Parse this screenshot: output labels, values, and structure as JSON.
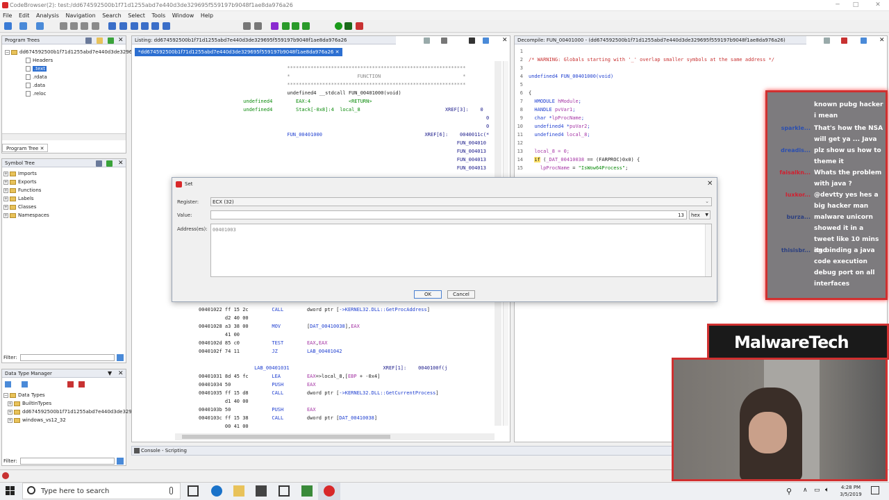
{
  "window": {
    "title": "CodeBrowser(2): test:/dd674592500b1f71d1255abd7e440d3de329695f559197b9048f1ae8da976a26"
  },
  "menu": [
    "File",
    "Edit",
    "Analysis",
    "Navigation",
    "Search",
    "Select",
    "Tools",
    "Window",
    "Help"
  ],
  "program_trees": {
    "title": "Program Trees",
    "root": "dd674592500b1f71d1255abd7e440d3de3296",
    "items": [
      "Headers",
      ".text",
      ".rdata",
      ".data",
      ".reloc"
    ],
    "tab": "Program Tree"
  },
  "symbol_tree": {
    "title": "Symbol Tree",
    "items": [
      "Imports",
      "Exports",
      "Functions",
      "Labels",
      "Classes",
      "Namespaces"
    ]
  },
  "filter_label": "Filter:",
  "data_type_manager": {
    "title": "Data Type Manager",
    "root": "Data Types",
    "items": [
      "BuiltInTypes",
      "dd674592500b1f71d1255abd7e440d3de3296",
      "windows_vs12_32"
    ]
  },
  "listing": {
    "title": "Listing: dd674592500b1f71d1255abd7e440d3de329695f559197b9048f1ae8da976a26",
    "tab": "*dd674592500b1f71d1255abd7e440d3de329695f559197b9048f1ae8da976a26"
  },
  "decompile": {
    "title": "Decompile: FUN_00401000 - (dd674592500b1f71d1255abd7e440d3de329695f559197b9048f1ae8da976a26)"
  },
  "console_tab": "Console - Scripting",
  "dialog": {
    "title": "Set",
    "register_label": "Register:",
    "register_value": "ECX (32)",
    "value_label": "Value:",
    "value": "13",
    "format": "hex",
    "address_label": "Address(es):",
    "address_value": "00401003",
    "ok": "OK",
    "cancel": "Cancel"
  },
  "chat": {
    "messages": [
      {
        "user": "",
        "text": "known pubg hacker i mean"
      },
      {
        "user": "sparkle...",
        "text": "That's how the NSA will get ya ... Java"
      },
      {
        "user": "dreadis...",
        "text": "plz show us how to theme it"
      },
      {
        "user": "faisalkn...",
        "text": "Whats the problem with java ?"
      },
      {
        "user": "luxkor...",
        "text": "@devtty yes hes a big hacker man"
      },
      {
        "user": "burza...",
        "text": "malware unicorn showed it in a tweet like 10 mins ago"
      },
      {
        "user": "thisisbr...",
        "text": "its binding a java code execution debug port on all interfaces"
      }
    ]
  },
  "stream": {
    "logo": "MalwareTech"
  },
  "taskbar": {
    "search_placeholder": "Type here to search",
    "time": "4:28 PM",
    "date": "3/5/2019"
  }
}
